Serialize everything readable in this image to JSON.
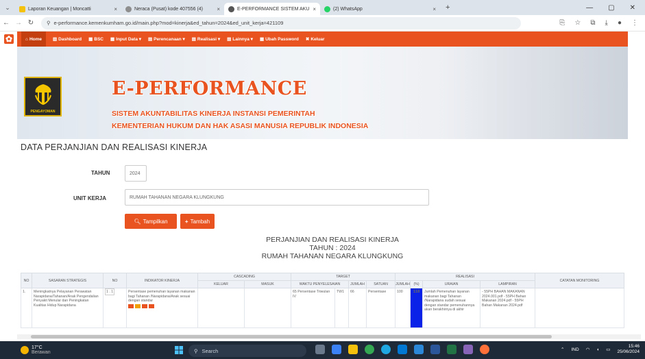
{
  "browser": {
    "tabs": [
      {
        "label": "Laporan Keuangan | Moncatti",
        "active": false,
        "color": "#f4c20d"
      },
      {
        "label": "Neraca (Pusat) kode 407556 (4)",
        "active": false,
        "color": "#8e8e8e"
      },
      {
        "label": "E-PERFORMANCE SISTEM AKU",
        "active": true,
        "color": "#555"
      },
      {
        "label": "(2) WhatsApp",
        "active": false,
        "color": "#25d366"
      }
    ],
    "new_tab": "+",
    "url": "e-performance.kemenkumham.go.id/main.php?mod=kinerja&ed_tahun=2024&ed_unit_kerja=421109"
  },
  "menu": {
    "items": [
      {
        "label": "Home",
        "name": "home"
      },
      {
        "label": "Dashboard",
        "name": "dashboard"
      },
      {
        "label": "BSC",
        "name": "bsc"
      },
      {
        "label": "Input Data ▾",
        "name": "input-data"
      },
      {
        "label": "Perencanaan ▾",
        "name": "perencanaan"
      },
      {
        "label": "Realisasi ▾",
        "name": "realisasi"
      },
      {
        "label": "Lainnya ▾",
        "name": "lainnya"
      },
      {
        "label": "Ubah Password",
        "name": "ubah-password"
      },
      {
        "label": "Keluar",
        "name": "keluar"
      }
    ]
  },
  "banner": {
    "title": "E-PERFORMANCE",
    "subtitle1": "SISTEM AKUNTABILITAS KINERJA INSTANSI PEMERINTAH",
    "subtitle2": "KEMENTERIAN HUKUM DAN HAK ASASI MANUSIA REPUBLIK INDONESIA",
    "logo_label": "PENGAYOMAN"
  },
  "page": {
    "title": "DATA PERJANJIAN DAN REALISASI KINERJA",
    "tahun_label": "TAHUN",
    "tahun_value": "2024",
    "unit_label": "UNIT KERJA",
    "unit_value": "RUMAH TAHANAN NEGARA KLUNGKUNG",
    "btn_tampilkan": "Tampilkan",
    "btn_tambah": "Tambah"
  },
  "report": {
    "line1": "PERJANJIAN DAN REALISASI KINERJA",
    "line2": "TAHUN : 2024",
    "line3": "RUMAH TAHANAN NEGARA KLUNGKUNG"
  },
  "table": {
    "h_no": "NO",
    "h_sasaran": "SASARAN STRATEGIS",
    "h_no2": "NO",
    "h_indikator": "INDIKATOR KINERJA",
    "h_cascading": "CASCADING",
    "h_keluar": "KELUAR",
    "h_masuk": "MASUK",
    "h_target": "TARGET",
    "h_waktu": "WAKTU PENYELESAIAN",
    "h_jumlah": "JUMLAH",
    "h_satuan": "SATUAN",
    "h_realisasi": "REALISASI",
    "h_rjumlah": "JUMLAH",
    "h_persen": "(%)",
    "h_uraian": "URAIAN",
    "h_lampiran": "LAMPIRAN",
    "h_catatan": "CATATAN MONITORING",
    "row": {
      "no": "1.",
      "sasaran": "Meningkatnya Pelayanan Perawatan Narapidana/Tahanan/Anak Pengendalian Penyakit Menular dan Peningkatan Kualitas Hidup Narapidana",
      "no2": "1 . 1",
      "indikator": "Persentase pemenuhan layanan makanan bagi Tahanan /Narapidana/Anak sesuai dengan standar",
      "waktu": "65 Persentase Triwulan IV",
      "tw": "TW1",
      "jumlah": "66",
      "satuan": "Persentase",
      "rjumlah": "100",
      "persen": "118",
      "uraian": "Jumlah Pemenuhan layanan makanan bagi Tahanan /Narapidana sudah sesuai dengan standar pemenuhannya akan berakhirnya di akhir",
      "lampiran": "- 55PH BAHAN MAKANAN 2024.001.pdf - 55PH Bahan Makanan 2024.pdf - 55PH Bahan Makanan 2024.pdf"
    }
  },
  "taskbar": {
    "temp": "17°C",
    "weather": "Berawan",
    "search": "Search",
    "lang": "IND",
    "time": "15:46",
    "date": "25/06/2024"
  }
}
